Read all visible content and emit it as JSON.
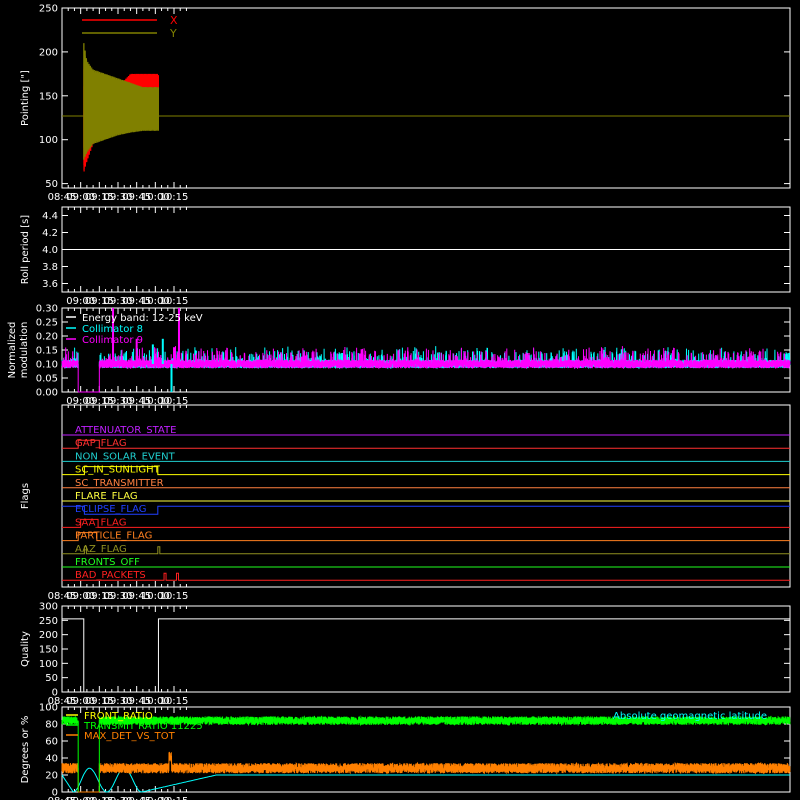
{
  "chart_data": [
    {
      "type": "line",
      "ylabel": "Pointing [\"]",
      "ylim": [
        45,
        250
      ],
      "yticks": [
        50,
        100,
        150,
        200,
        250
      ],
      "xlim": [
        525,
        1110
      ],
      "xtick_values": [
        525,
        540,
        555,
        570,
        585,
        600,
        615
      ],
      "xtick_labels": [
        "08:45",
        "09:00",
        "09:15",
        "09:30",
        "09:45",
        "10:00",
        "10:15"
      ],
      "legend": [
        {
          "name": "X",
          "color": "#ff0000"
        },
        {
          "name": "Y",
          "color": "#808000"
        }
      ],
      "series": [
        {
          "name": "X",
          "color": "#ff0000",
          "baseline": 127,
          "envelope": {
            "x": [
              542,
              545,
              550,
              560,
              570,
              580,
              590,
              600,
              602
            ],
            "low": [
              60,
              75,
              95,
              110,
              125,
              140,
              145,
              145,
              145
            ],
            "high": [
              190,
              185,
              170,
              160,
              160,
              175,
              175,
              175,
              175
            ]
          }
        },
        {
          "name": "Y",
          "color": "#808000",
          "baseline": 127,
          "envelope": {
            "x": [
              542,
              545,
              550,
              560,
              570,
              580,
              590,
              600,
              602
            ],
            "low": [
              75,
              85,
              95,
              100,
              105,
              108,
              110,
              110,
              110
            ],
            "high": [
              215,
              190,
              180,
              175,
              170,
              165,
              160,
              160,
              160
            ]
          }
        }
      ],
      "active_range": [
        542.5,
        602.5
      ]
    },
    {
      "type": "line",
      "ylabel": "Roll period [s]",
      "ylim": [
        3.5,
        4.5
      ],
      "yticks": [
        3.6,
        3.8,
        4.0,
        4.2,
        4.4
      ],
      "ytick_labels": [
        "3.6",
        "3.8",
        "4.0",
        "4.2",
        "4.4"
      ],
      "series": [
        {
          "name": "",
          "color": "#ffffff",
          "value": 4.0
        }
      ]
    },
    {
      "type": "line",
      "ylabel": "Normalized modulation",
      "ylim": [
        0,
        0.3
      ],
      "yticks": [
        0,
        0.05,
        0.1,
        0.15,
        0.2,
        0.25,
        0.3
      ],
      "ytick_labels": [
        "0.00",
        "0.05",
        "0.10",
        "0.15",
        "0.20",
        "0.25",
        "0.30"
      ],
      "legend": [
        {
          "name": "Energy band: 12-25 keV",
          "color": "#ffffff"
        },
        {
          "name": "Collimator 8",
          "color": "#00ffff"
        },
        {
          "name": "Collimator 9",
          "color": "#ff00ff"
        }
      ],
      "segments": [
        [
          525,
          538
        ],
        [
          555,
          1110
        ]
      ],
      "baseline_value": 0.1,
      "spikes": [
        {
          "x": 566,
          "v": 0.3,
          "c": "#ff00ff"
        },
        {
          "x": 585,
          "v": 0.19,
          "c": "#ff00ff"
        },
        {
          "x": 598,
          "v": 0.17,
          "c": "#00ffff"
        },
        {
          "x": 606,
          "v": 0.19,
          "c": "#00ffff"
        },
        {
          "x": 615,
          "v": 0.16,
          "c": "#ff00ff"
        },
        {
          "x": 619,
          "v": 0.3,
          "c": "#ff00ff"
        },
        {
          "x": 613,
          "v": 0.0,
          "c": "#00ffff"
        }
      ]
    },
    {
      "type": "line",
      "ylabel": "Flags",
      "flags": [
        {
          "name": "ATTENUATOR_STATE",
          "color": "#c020ff",
          "steps": []
        },
        {
          "name": "GAP_FLAG",
          "color": "#ff3030",
          "steps": [
            [
              525,
              0
            ],
            [
              538,
              1
            ],
            [
              555,
              0
            ]
          ]
        },
        {
          "name": "NON_SOLAR_EVENT",
          "color": "#20d0d0",
          "steps": []
        },
        {
          "name": "SC_IN_SUNLIGHT",
          "color": "#ffff00",
          "steps": [
            [
              525,
              0
            ],
            [
              543,
              1
            ],
            [
              602,
              0
            ]
          ]
        },
        {
          "name": "SC_TRANSMITTER",
          "color": "#ff8040",
          "steps": []
        },
        {
          "name": "FLARE_FLAG",
          "color": "#ffff40",
          "steps": []
        },
        {
          "name": "ECLIPSE_FLAG",
          "color": "#2040ff",
          "steps": [
            [
              525,
              1
            ],
            [
              543,
              0
            ],
            [
              602,
              1
            ]
          ]
        },
        {
          "name": "SAA_FLAG",
          "color": "#ff2020",
          "steps": [
            [
              525,
              0
            ],
            [
              540,
              1
            ],
            [
              554,
              0
            ]
          ]
        },
        {
          "name": "PARTICLE_FLAG",
          "color": "#ff8020",
          "steps": [
            [
              525,
              0
            ],
            [
              538,
              1
            ],
            [
              553,
              0
            ]
          ]
        },
        {
          "name": "AAZ_FLAG",
          "color": "#909020",
          "pulses": [
            543,
            602
          ]
        },
        {
          "name": "FRONTS_OFF",
          "color": "#20ff20",
          "steps": []
        },
        {
          "name": "BAD_PACKETS",
          "color": "#ff2020",
          "pulses": [
            607,
            617
          ]
        }
      ]
    },
    {
      "type": "line",
      "ylabel": "Quality",
      "ylim": [
        0,
        300
      ],
      "yticks": [
        0,
        50,
        100,
        150,
        200,
        250,
        300
      ],
      "series": [
        {
          "name": "",
          "color": "#ffffff",
          "steps": [
            [
              525,
              255
            ],
            [
              542.5,
              0
            ],
            [
              602.5,
              255
            ],
            [
              620,
              255
            ]
          ]
        }
      ]
    },
    {
      "type": "line",
      "ylabel": "Degrees or %",
      "ylim": [
        0,
        100
      ],
      "yticks": [
        0,
        20,
        40,
        60,
        80,
        100
      ],
      "legend": [
        {
          "name": "FRONT_RATIO",
          "color": "#ffff00"
        },
        {
          "name": "TRANSMIT RATIO 11225",
          "color": "#00ff00"
        },
        {
          "name": "MAX_DET_VS_TOT",
          "color": "#ff8000"
        }
      ],
      "annotation": {
        "text": "Absolute geomagnetic latitude",
        "color": "#00ffff"
      },
      "segments": [
        [
          525,
          538
        ],
        [
          555,
          1110
        ]
      ],
      "front_ratio": 84,
      "max_det": 28,
      "max_det_high": {
        "x0": 611,
        "x1": 613,
        "v": 42
      },
      "latitude_peaks": [
        {
          "x": 534,
          "v": 0
        },
        {
          "x": 547,
          "v": 28
        },
        {
          "x": 561,
          "v": 0
        },
        {
          "x": 575,
          "v": 28
        },
        {
          "x": 589,
          "v": 0
        }
      ]
    }
  ]
}
